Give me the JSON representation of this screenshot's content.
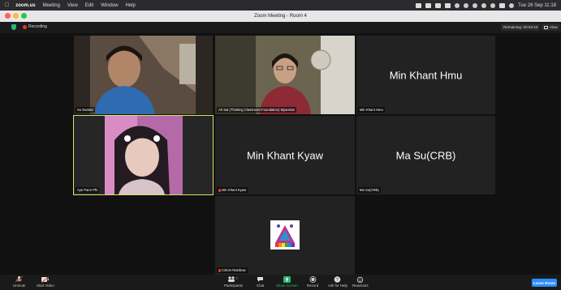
{
  "menubar": {
    "items": [
      "zoom.us",
      "Meeting",
      "View",
      "Edit",
      "Window",
      "Help"
    ],
    "datetime": "Tue 28 Sep 11:18"
  },
  "window": {
    "title": "Zoom Meeting - Room 4"
  },
  "meeting": {
    "recording_label": "Recording",
    "remaining_label": "Remaining: 00:03:43",
    "view_label": "View"
  },
  "participants": [
    {
      "name": "Su Nandar",
      "video": true
    },
    {
      "name": "Ah Sai (Thinking Classroom Foundation) Myanmar",
      "video": true
    },
    {
      "name": "Min Khant Hmu",
      "video": false,
      "display": "Min Khant Hmu"
    },
    {
      "name": "Aye Pann Phi",
      "video": true
    },
    {
      "name": "Min Khant Kyaw",
      "video": false,
      "display": "Min Khant Kyaw"
    },
    {
      "name": "Ma Su(CRB)",
      "video": false,
      "display": "Ma Su(CRB)"
    },
    {
      "name": "Colors Rainbow",
      "video": false
    }
  ],
  "toolbar": {
    "unmute": "Unmute",
    "start_video": "Start Video",
    "participants": "Participants",
    "participants_count": "7",
    "chat": "Chat",
    "share_screen": "Share Screen",
    "record": "Record",
    "ask_for_help": "Ask for Help",
    "reactions": "Reactions",
    "leave_room": "Leave Room"
  },
  "colors": {
    "accent": "#2d8cff",
    "active_speaker": "#d8e36a",
    "share_green": "#2bb673",
    "recording_red": "#e53935"
  }
}
